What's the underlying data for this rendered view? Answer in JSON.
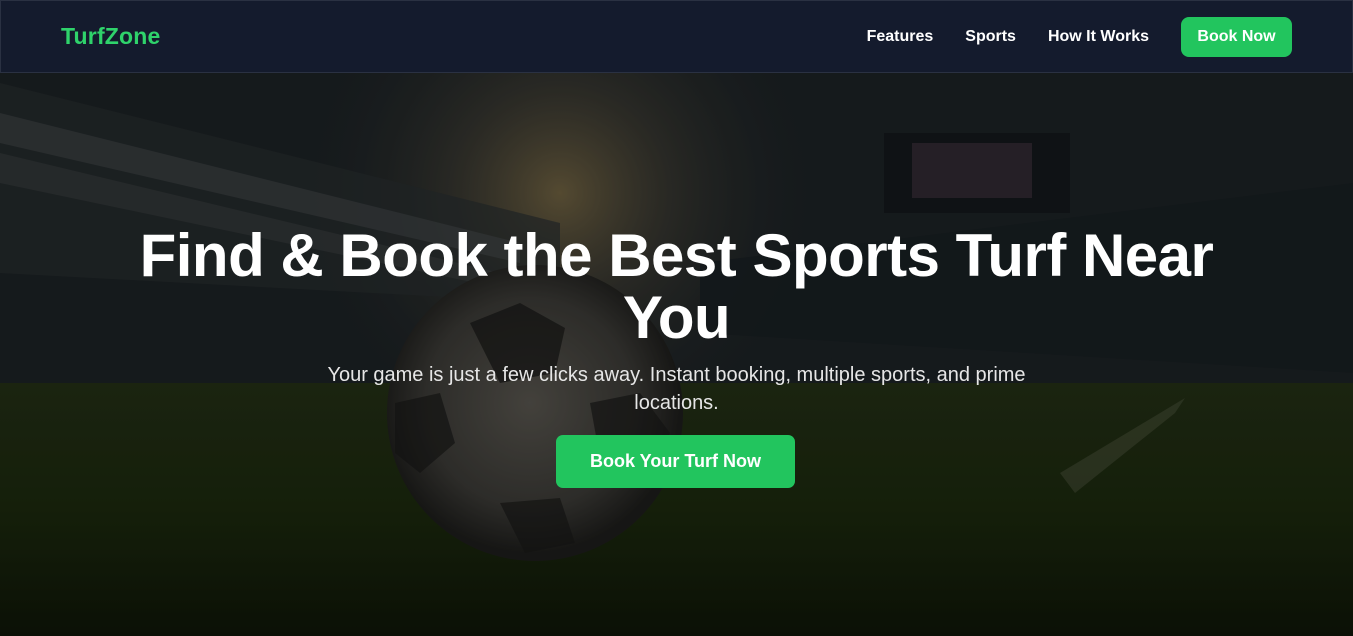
{
  "navbar": {
    "logo": "TurfZone",
    "links": [
      {
        "label": "Features"
      },
      {
        "label": "Sports"
      },
      {
        "label": "How It Works"
      }
    ],
    "cta_label": "Book Now"
  },
  "hero": {
    "title": "Find & Book the Best Sports Turf Near You",
    "subtitle": "Your game is just a few clicks away. Instant booking, multiple sports, and prime locations.",
    "cta_label": "Book Your Turf Now"
  },
  "colors": {
    "brand_green": "#22c55e",
    "logo_green": "#2fd36b",
    "navbar_bg": "#141b2d"
  }
}
